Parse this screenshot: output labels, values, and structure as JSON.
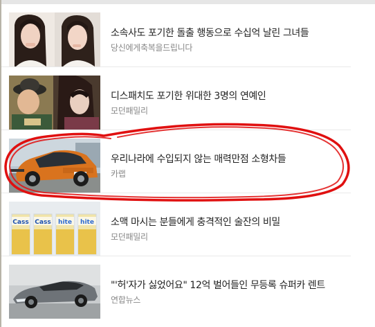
{
  "articles": [
    {
      "title": "소속사도 포기한 돌출 행동으로 수십억 날린 그녀들",
      "source": "당신에게축복을드립니다",
      "thumbnail": "two-portraits-photo"
    },
    {
      "title": "디스패치도 포기한 위대한 3명의 연예인",
      "source": "모던패밀리",
      "thumbnail": "celebrities-photo"
    },
    {
      "title": "우리나라에 수입되지 않는 매력만점 소형차들",
      "source": "카랩",
      "thumbnail": "orange-car-photo"
    },
    {
      "title": "소맥 마시는 분들에게 충격적인 술잔의 비밀",
      "source": "모던패밀리",
      "thumbnail": "beer-glasses-photo"
    },
    {
      "title": "\"'허'자가 싫었어요\" 12억 벌어들인 무등록 슈퍼카 렌트",
      "source": "연합뉴스",
      "thumbnail": "supercar-photo"
    }
  ],
  "beer_glass_labels": [
    "Cass",
    "Cass",
    "hite",
    "hite"
  ],
  "colors": {
    "annotation": "#e01010",
    "title": "#222222",
    "source": "#888888",
    "orange_car": "#d9731e"
  }
}
